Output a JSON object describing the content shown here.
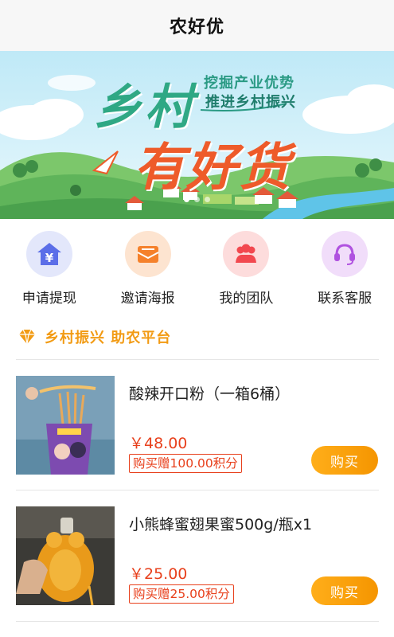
{
  "header": {
    "title": "农好优"
  },
  "banner": {
    "tag_line1": "挖掘产业优势",
    "tag_line2": "推进乡村振兴",
    "big_line1": "乡村",
    "big_line2": "有好货"
  },
  "quick_actions": [
    {
      "label": "申请提现",
      "icon": "yuan-home-icon",
      "color": "#5b6ee8"
    },
    {
      "label": "邀请海报",
      "icon": "envelope-icon",
      "color": "#f5812b"
    },
    {
      "label": "我的团队",
      "icon": "team-icon",
      "color": "#f2484f"
    },
    {
      "label": "联系客服",
      "icon": "headset-icon",
      "color": "#b052e0"
    }
  ],
  "section": {
    "title": "乡村振兴 助农平台",
    "icon": "diamond-icon",
    "accent": "#f29b14"
  },
  "products": [
    {
      "name": "酸辣开口粉（一箱6桶）",
      "price": "￥48.00",
      "points": "购买赠100.00积分",
      "buy_label": "购买"
    },
    {
      "name": "小熊蜂蜜翅果蜜500g/瓶x1",
      "price": "￥25.00",
      "points": "购买赠25.00积分",
      "buy_label": "购买"
    }
  ]
}
